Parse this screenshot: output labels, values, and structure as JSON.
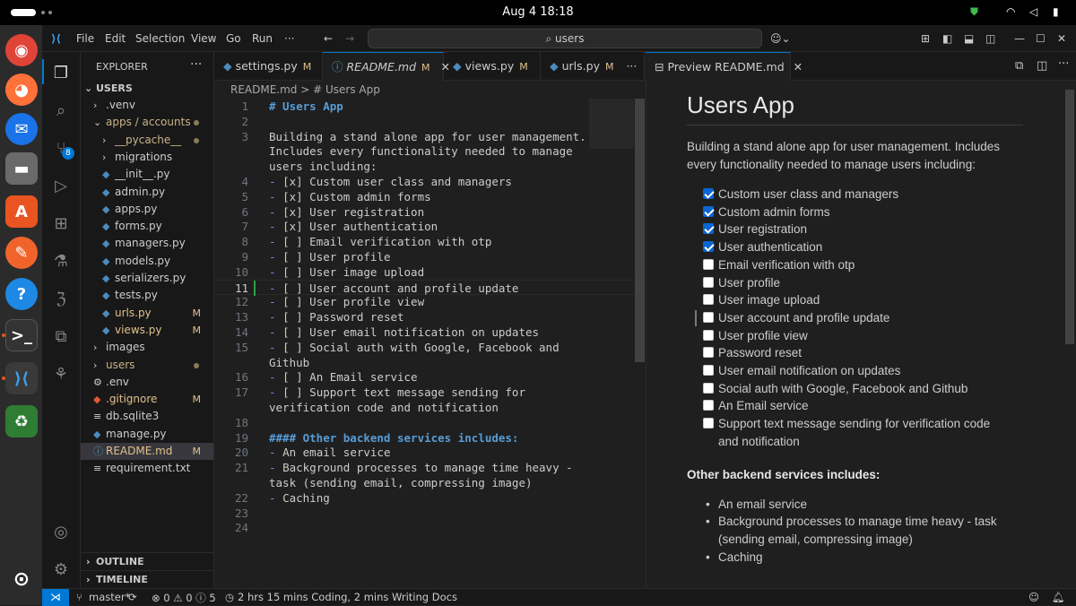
{
  "system": {
    "clock": "Aug 4  18:18"
  },
  "app": {
    "menu": [
      "File",
      "Edit",
      "Selection",
      "View",
      "Go",
      "Run",
      "···"
    ],
    "search": "⌕ users"
  },
  "explorer": {
    "title": "EXPLORER",
    "root": "USERS",
    "items": [
      {
        "label": ".venv",
        "indent": 1,
        "type": "folder-closed",
        "status": ""
      },
      {
        "label": "apps / accounts",
        "indent": 1,
        "type": "folder-open",
        "status": "dot"
      },
      {
        "label": "__pycache__",
        "indent": 2,
        "type": "folder-closed",
        "status": "dot"
      },
      {
        "label": "migrations",
        "indent": 2,
        "type": "folder-closed",
        "status": ""
      },
      {
        "label": "__init__.py",
        "indent": 2,
        "type": "py",
        "status": ""
      },
      {
        "label": "admin.py",
        "indent": 2,
        "type": "py",
        "status": ""
      },
      {
        "label": "apps.py",
        "indent": 2,
        "type": "py",
        "status": ""
      },
      {
        "label": "forms.py",
        "indent": 2,
        "type": "py",
        "status": ""
      },
      {
        "label": "managers.py",
        "indent": 2,
        "type": "py",
        "status": ""
      },
      {
        "label": "models.py",
        "indent": 2,
        "type": "py",
        "status": ""
      },
      {
        "label": "serializers.py",
        "indent": 2,
        "type": "py",
        "status": ""
      },
      {
        "label": "tests.py",
        "indent": 2,
        "type": "py",
        "status": ""
      },
      {
        "label": "urls.py",
        "indent": 2,
        "type": "py",
        "status": "M"
      },
      {
        "label": "views.py",
        "indent": 2,
        "type": "py",
        "status": "M"
      },
      {
        "label": "images",
        "indent": 1,
        "type": "folder-closed",
        "status": ""
      },
      {
        "label": "users",
        "indent": 1,
        "type": "folder-closed",
        "status": "dot"
      },
      {
        "label": ".env",
        "indent": 1,
        "type": "env",
        "status": ""
      },
      {
        "label": ".gitignore",
        "indent": 1,
        "type": "git",
        "status": "M"
      },
      {
        "label": "db.sqlite3",
        "indent": 1,
        "type": "file",
        "status": ""
      },
      {
        "label": "manage.py",
        "indent": 1,
        "type": "py",
        "status": ""
      },
      {
        "label": "README.md",
        "indent": 1,
        "type": "md",
        "status": "M"
      },
      {
        "label": "requirement.txt",
        "indent": 1,
        "type": "file",
        "status": ""
      }
    ],
    "outline": "OUTLINE",
    "timeline": "TIMELINE"
  },
  "tabs": [
    {
      "label": "settings.py",
      "mark": "M",
      "active": false
    },
    {
      "label": "README.md",
      "mark": "M",
      "active": true
    },
    {
      "label": "views.py",
      "mark": "M",
      "active": false
    },
    {
      "label": "urls.py",
      "mark": "M",
      "active": false
    }
  ],
  "breadcrumb": "README.md  >  # Users App",
  "code": [
    {
      "n": "1",
      "t": "# Users App",
      "kind": "h1"
    },
    {
      "n": "2",
      "t": "",
      "kind": "plain"
    },
    {
      "n": "3",
      "t": "Building a stand alone app for user management.",
      "kind": "plain"
    },
    {
      "n": "",
      "t": "Includes every functionality needed to manage",
      "kind": "plain"
    },
    {
      "n": "",
      "t": "users including:",
      "kind": "plain"
    },
    {
      "n": "4",
      "t": "- [x] Custom user class and managers",
      "kind": "li"
    },
    {
      "n": "5",
      "t": "- [x] Custom admin forms",
      "kind": "li"
    },
    {
      "n": "6",
      "t": "- [x] User registration",
      "kind": "li"
    },
    {
      "n": "7",
      "t": "- [x] User authentication",
      "kind": "li"
    },
    {
      "n": "8",
      "t": "- [ ] Email verification with otp",
      "kind": "li"
    },
    {
      "n": "9",
      "t": "- [ ] User profile",
      "kind": "li"
    },
    {
      "n": "10",
      "t": "- [ ] User image upload",
      "kind": "li"
    },
    {
      "n": "11",
      "t": "- [ ] User account and profile update",
      "kind": "li-cur"
    },
    {
      "n": "12",
      "t": "- [ ] User profile view",
      "kind": "li"
    },
    {
      "n": "13",
      "t": "- [ ] Password reset",
      "kind": "li"
    },
    {
      "n": "14",
      "t": "- [ ] User email notification on updates",
      "kind": "li"
    },
    {
      "n": "15",
      "t": "- [ ] Social auth with Google, Facebook and",
      "kind": "li"
    },
    {
      "n": "",
      "t": "Github",
      "kind": "plain"
    },
    {
      "n": "16",
      "t": "- [ ] An Email service",
      "kind": "li"
    },
    {
      "n": "17",
      "t": "- [ ] Support text message sending for",
      "kind": "li"
    },
    {
      "n": "",
      "t": "verification code and notification",
      "kind": "plain"
    },
    {
      "n": "18",
      "t": "",
      "kind": "plain"
    },
    {
      "n": "19",
      "t": "#### Other backend services includes:",
      "kind": "h1"
    },
    {
      "n": "20",
      "t": "- An email service",
      "kind": "li"
    },
    {
      "n": "21",
      "t": "- Background processes to manage time heavy -",
      "kind": "li"
    },
    {
      "n": "",
      "t": "task (sending email, compressing image)",
      "kind": "plain"
    },
    {
      "n": "22",
      "t": "- Caching",
      "kind": "li"
    },
    {
      "n": "23",
      "t": "",
      "kind": "plain"
    },
    {
      "n": "24",
      "t": "",
      "kind": "plain"
    }
  ],
  "preview": {
    "tab": "Preview README.md",
    "title": "Users App",
    "intro": "Building a stand alone app for user management. Includes every functionality needed to manage users including:",
    "tasks": [
      {
        "label": "Custom user class and managers",
        "checked": true
      },
      {
        "label": "Custom admin forms",
        "checked": true
      },
      {
        "label": "User registration",
        "checked": true
      },
      {
        "label": "User authentication",
        "checked": true
      },
      {
        "label": "Email verification with otp",
        "checked": false
      },
      {
        "label": "User profile",
        "checked": false
      },
      {
        "label": "User image upload",
        "checked": false
      },
      {
        "label": "User account and profile update",
        "checked": false
      },
      {
        "label": "User profile view",
        "checked": false
      },
      {
        "label": "Password reset",
        "checked": false
      },
      {
        "label": "User email notification on updates",
        "checked": false
      },
      {
        "label": "Social auth with Google, Facebook and Github",
        "checked": false
      },
      {
        "label": "An Email service",
        "checked": false
      },
      {
        "label": "Support text message sending for verification code and notification",
        "checked": false
      }
    ],
    "subheading": "Other backend services includes:",
    "bullets": [
      "An email service",
      "Background processes to manage time heavy - task (sending email, compressing image)",
      "Caching"
    ]
  },
  "statusbar": {
    "branch": "master*",
    "problems": "⊗ 0 ⚠ 0 ⓘ 5",
    "activity": "2 hrs 15 mins Coding, 2 mins Writing Docs"
  },
  "colors": {
    "accent": "#0078d4",
    "modified": "#e2c08d",
    "heading": "#569cd6",
    "checkbox": "#0a66d2"
  }
}
